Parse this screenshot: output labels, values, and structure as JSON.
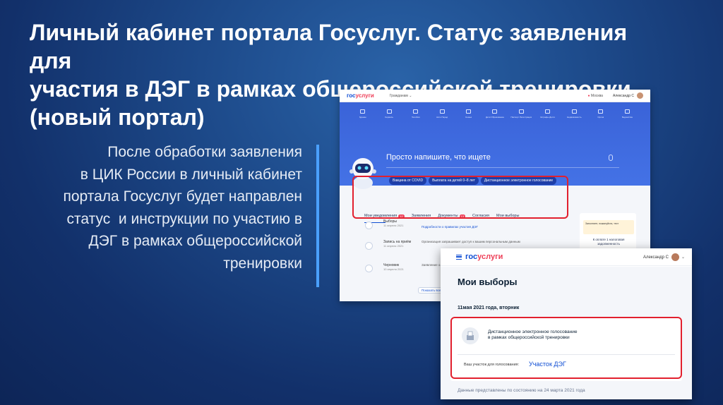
{
  "slide": {
    "title_lines": [
      "Личный кабинет портала Госуслуг. Статус заявления для",
      "участия в ДЭГ в рамках общероссийской тренировки",
      "(новый портал)"
    ],
    "body_lines": [
      "После обработки заявления",
      "в ЦИК России в личный кабинет",
      "портала Госуслуг будет направлен",
      "статус  и инструкции по участию в",
      "ДЭГ в рамках общероссийской",
      "тренировки"
    ],
    "accent_color": "#4aa0ff",
    "highlight_color": "#e2202e"
  },
  "portal": {
    "logo_part1": "гос",
    "logo_part2": "услуги",
    "citizen_menu": "Гражданам ⌄",
    "city": "Москва",
    "user": "Александр С",
    "nav": [
      {
        "icon": "car-icon",
        "label": "Здание"
      },
      {
        "icon": "service-icon",
        "label": "Сервисы"
      },
      {
        "icon": "benefit-icon",
        "label": "Пособия"
      },
      {
        "icon": "transport-icon",
        "label": "Авто Перед"
      },
      {
        "icon": "family-icon",
        "label": "Семья"
      },
      {
        "icon": "education-icon",
        "label": "Дети Образование"
      },
      {
        "icon": "doc-icon",
        "label": "Паспорт Регистрация"
      },
      {
        "icon": "fine-icon",
        "label": "Штрафы Долги"
      },
      {
        "icon": "property-icon",
        "label": "Недвижимость"
      },
      {
        "icon": "job-icon",
        "label": "Орлов"
      },
      {
        "icon": "ministry-icon",
        "label": "Ведомства"
      }
    ],
    "search_placeholder": "Просто напишите, что ищете",
    "chips": [
      "Вакцина от COVID",
      "Выплата на детей 0–8 лет",
      "Дистанционное электронное голосование"
    ],
    "tabs": [
      {
        "label": "Мои уведомления",
        "badge": "12"
      },
      {
        "label": "Заявления",
        "badge": ""
      },
      {
        "label": "Документы",
        "badge": "13"
      },
      {
        "label": "Согласия",
        "badge": ""
      },
      {
        "label": "Мои выборы",
        "badge": ""
      }
    ],
    "rows": [
      {
        "title": "Выборы",
        "date": "11 апреля 2021",
        "link": "Подробности о правилах участия ДЭГ"
      },
      {
        "title": "Запись на приём",
        "date": "11 апреля 2021",
        "text": "Организация запрашивает доступ к вашим персональным данным"
      },
      {
        "title": "Черновик",
        "date": "10 апреля 2021",
        "text": "Заявление о..."
      }
    ],
    "side_warning": "Заполните, пожалуйста, тест",
    "side_note": "К оплате 1 налоговая задолженность",
    "more_button": "Показать все"
  },
  "elections": {
    "logo_part1": "гос",
    "logo_part2": "услуги",
    "user": "Александр С",
    "title": "Мои выборы",
    "date": "11мая 2021 года, вторник",
    "card_text_1": "Дистанционное электронное голосование",
    "card_text_2": "в рамках общероссийской тренировки",
    "station_label": "Ваш участок для голосования:",
    "station_link": "Участок ДЭГ",
    "footer": "Данные представлены по состоянию на 24 марта 2021 года"
  }
}
